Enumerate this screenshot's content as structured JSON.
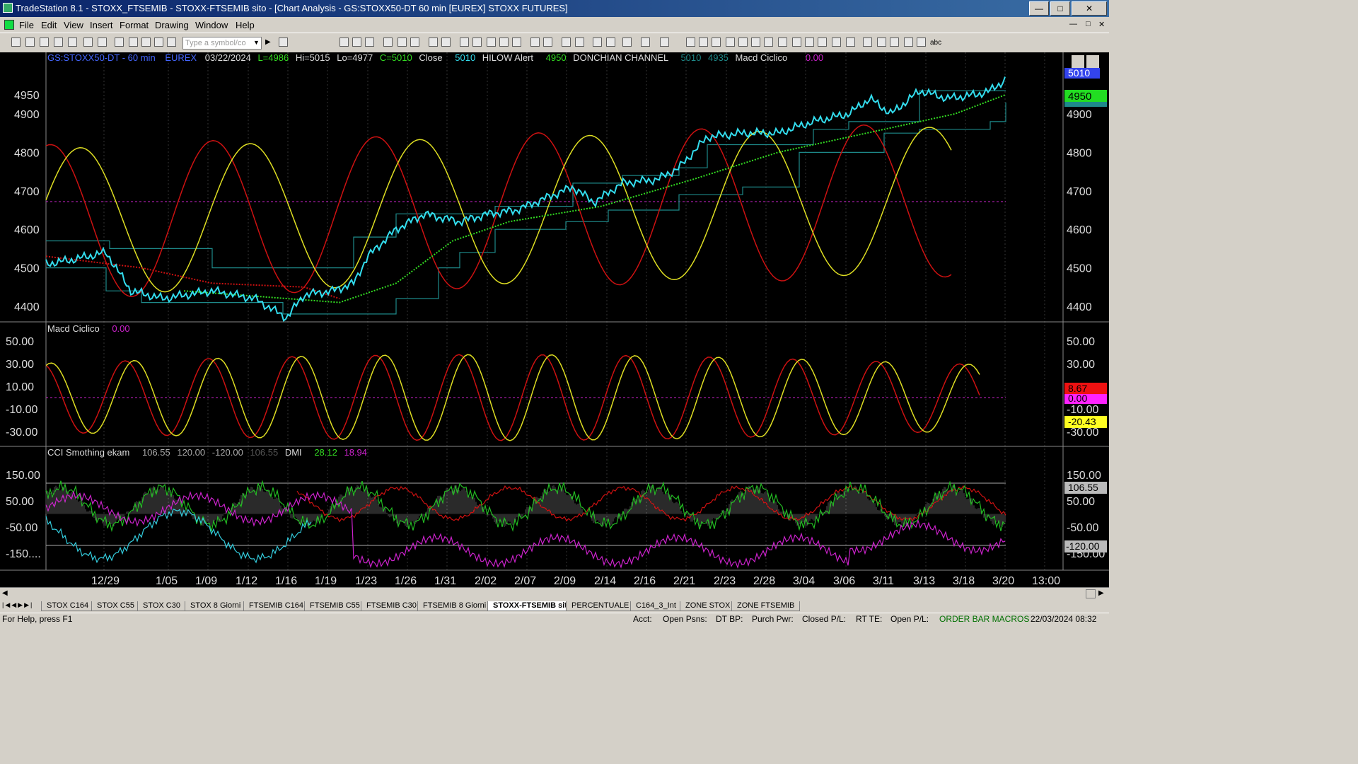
{
  "window": {
    "title": "TradeStation 8.1 - STOXX_FTSEMIB - STOXX-FTSEMIB sito - [Chart Analysis - GS:STOXX50-DT  60 min  [EUREX] STOXX FUTURES]"
  },
  "menu": [
    "File",
    "Edit",
    "View",
    "Insert",
    "Format",
    "Drawing",
    "Window",
    "Help"
  ],
  "toolbar": {
    "symbol_placeholder": "Type a symbol/co"
  },
  "header": {
    "symbol": "GS:STOXX50-DT - 60 min",
    "exchange": "EUREX",
    "date": "03/22/2024",
    "last": "L=4986",
    "hi": "Hi=5015",
    "lo": "Lo=4977",
    "close": "C=5010",
    "close_label": "Close",
    "close_val": "5010",
    "hilow_label": "HILOW Alert",
    "hilow_val": "4950",
    "donchian_label": "DONCHIAN CHANNEL",
    "don1": "5010",
    "don2": "4935",
    "macd_label": "Macd Ciclico",
    "macd_val": "0.00"
  },
  "panel2": {
    "label": "Macd Ciclico",
    "val": "0.00"
  },
  "panel3": {
    "label": "CCI Smothing ekam",
    "v1": "106.55",
    "v2": "120.00",
    "v3": "-120.00",
    "v4": "106.55",
    "dmi_label": "DMI",
    "dmi1": "28.12",
    "dmi2": "18.94"
  },
  "price_axis": [
    "4950",
    "4900",
    "4800",
    "4700",
    "4600",
    "4500",
    "4400"
  ],
  "right_axis": [
    "4900",
    "4800",
    "4700",
    "4600",
    "4500",
    "4400"
  ],
  "price_badges": {
    "top": "5010",
    "green": "4950"
  },
  "macd_axis": [
    "50.00",
    "30.00",
    "10.00",
    "-10.00",
    "-30.00"
  ],
  "macd_badges": {
    "red": "8.67",
    "magenta": "0.00",
    "yellow": "-20.43"
  },
  "cci_axis": [
    "150.00",
    "50.00",
    "-50.00",
    "-150...."
  ],
  "cci_right_axis": [
    "150.00",
    "50.00",
    "-50.00",
    "-150.00"
  ],
  "cci_badges": {
    "grey": "106.55",
    "grey2": "-120.00"
  },
  "x_labels": [
    "12/29",
    "1/05",
    "1/09",
    "1/12",
    "1/16",
    "1/19",
    "1/23",
    "1/26",
    "1/31",
    "2/02",
    "2/07",
    "2/09",
    "2/14",
    "2/16",
    "2/21",
    "2/23",
    "2/28",
    "3/04",
    "3/06",
    "3/11",
    "3/13",
    "3/18",
    "3/20",
    "13:00"
  ],
  "tabs": [
    "STOX C164",
    "STOX C55",
    "STOX  C30",
    "STOX  8 Giorni",
    "FTSEMIB C164",
    "FTSEMIB C55",
    "FTSEMIB C30",
    "FTSEMIB  8 Giorni",
    "STOXX-FTSEMIB sito",
    "PERCENTUALE",
    "C164_3_Int",
    "ZONE STOX",
    "ZONE FTSEMIB"
  ],
  "status": {
    "help": "For Help, press F1",
    "acct": "Acct:",
    "open_psns": "Open Psns:",
    "dt_bp": "DT BP:",
    "purch_pwr": "Purch Pwr:",
    "closed_pl": "Closed P/L:",
    "rt_te": "RT TE:",
    "open_pl": "Open P/L:",
    "macros": "ORDER BAR  MACROS",
    "datetime": "22/03/2024 08:32"
  },
  "colors": {
    "price": "#33ddee",
    "red": "#cc1111",
    "yellow": "#dddd22",
    "green_dot": "#33dd22",
    "donchian": "#1e8a8a",
    "magenta": "#cc22cc",
    "cci_green": "#22bb22"
  }
}
